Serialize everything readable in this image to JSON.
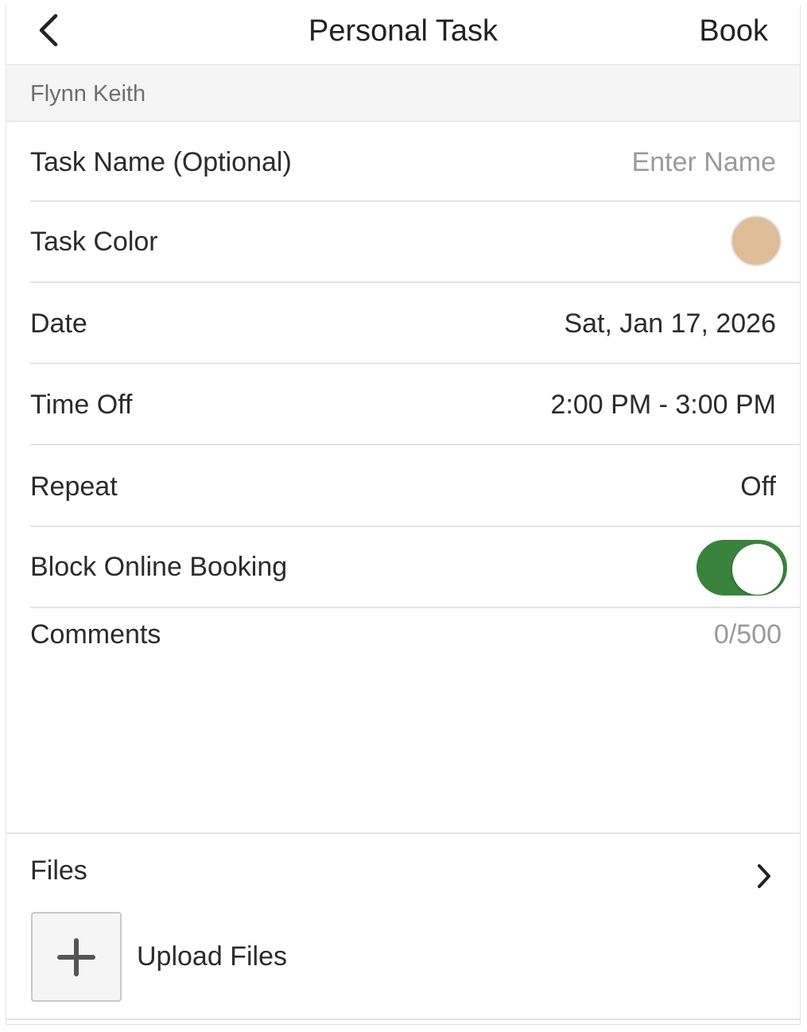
{
  "header": {
    "title": "Personal Task",
    "action_label": "Book"
  },
  "staff": {
    "name": "Flynn Keith"
  },
  "form": {
    "task_name": {
      "label": "Task Name (Optional)",
      "value": "",
      "placeholder": "Enter Name"
    },
    "task_color": {
      "label": "Task Color",
      "color": "#DEBC98"
    },
    "date": {
      "label": "Date",
      "value": "Sat, Jan 17, 2026"
    },
    "time_off": {
      "label": "Time Off",
      "value": "2:00 PM - 3:00 PM"
    },
    "repeat": {
      "label": "Repeat",
      "value": "Off"
    },
    "block_online_booking": {
      "label": "Block Online Booking",
      "enabled": true,
      "on_color": "#3A833C"
    },
    "comments": {
      "label": "Comments",
      "counter": "0/500",
      "value": ""
    }
  },
  "files": {
    "label": "Files",
    "upload_label": "Upload Files"
  },
  "icons": {
    "back": "chevron-left-icon",
    "files_nav": "chevron-right-icon",
    "upload": "plus-icon"
  }
}
